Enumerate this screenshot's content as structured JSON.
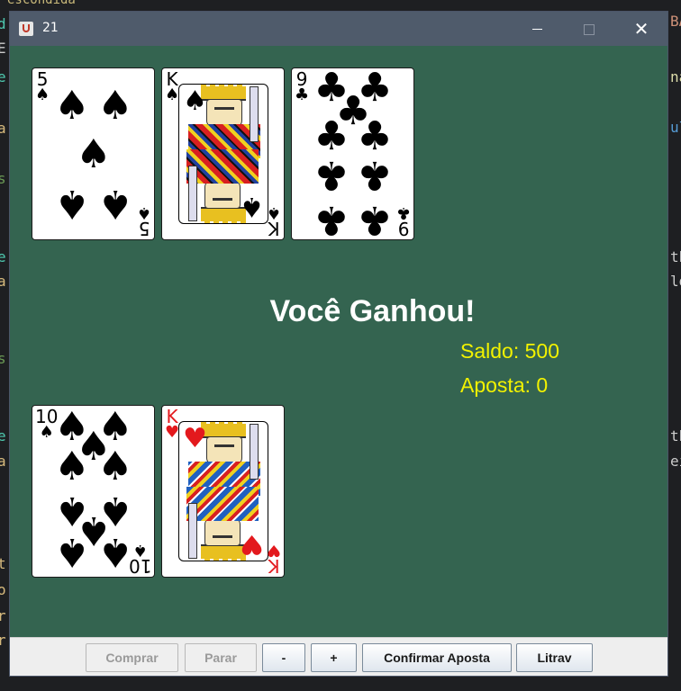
{
  "background": {
    "code_top": "escondida",
    "left_fragments": [
      "d",
      "E",
      "e",
      "a",
      "s",
      "e",
      "a",
      "s",
      "e",
      "a",
      "t",
      "o",
      "r",
      "r"
    ],
    "right_fragments": [
      "BA",
      "na",
      "ul",
      "th",
      "ld",
      "th",
      "ei"
    ]
  },
  "window": {
    "title": "21",
    "controls": {
      "minimize": "",
      "maximize": "",
      "close": "✕"
    }
  },
  "dealer_cards": [
    {
      "rank": "5",
      "suit": "♠",
      "color": "#000000"
    },
    {
      "rank": "K",
      "suit": "♠",
      "color": "#000000"
    },
    {
      "rank": "9",
      "suit": "♣",
      "color": "#000000"
    }
  ],
  "player_cards": [
    {
      "rank": "10",
      "suit": "♠",
      "color": "#000000"
    },
    {
      "rank": "K",
      "suit": "♥",
      "color": "#e3191d"
    }
  ],
  "game": {
    "result": "Você Ganhou!",
    "saldo": "Saldo: 500",
    "aposta": "Aposta: 0"
  },
  "toolbar": {
    "comprar": "Comprar",
    "parar": "Parar",
    "minus": "-",
    "plus": "+",
    "confirmar": "Confirmar Aposta",
    "litrav": "Litrav"
  },
  "colors": {
    "table_green": "#346450",
    "status_yellow": "#f2f200",
    "titlebar": "#4f5b6b"
  }
}
